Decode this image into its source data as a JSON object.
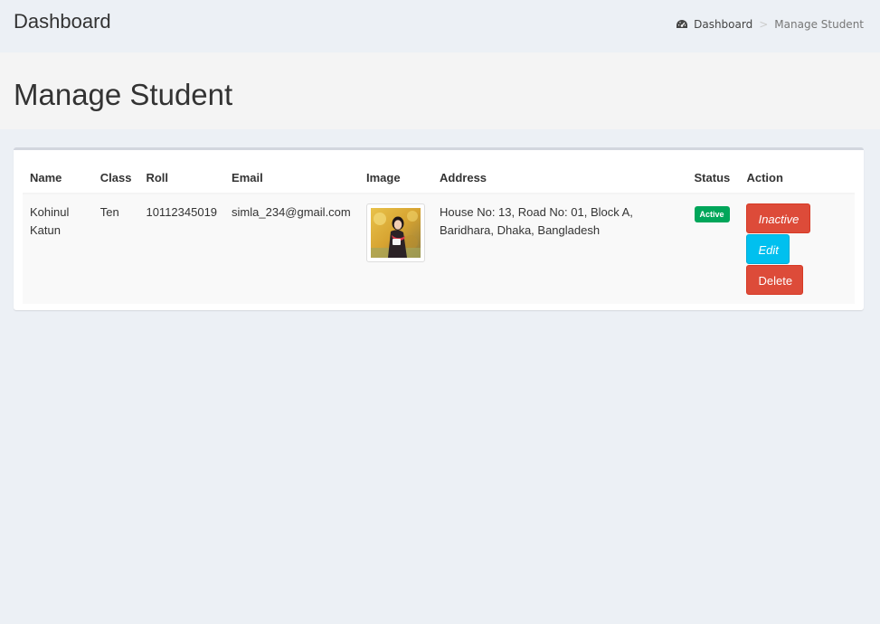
{
  "header": {
    "title": "Dashboard",
    "breadcrumb": {
      "home_label": "Dashboard",
      "separator": ">",
      "current": "Manage Student"
    }
  },
  "page": {
    "title": "Manage Student"
  },
  "table": {
    "columns": [
      "Name",
      "Class",
      "Roll",
      "Email",
      "Image",
      "Address",
      "Status",
      "Action"
    ],
    "rows": [
      {
        "name_line1": "Kohinul",
        "name_line2": "Katun",
        "class": "Ten",
        "roll": "10112345019",
        "email": "simla_234@gmail.com",
        "image_icon": "student-photo",
        "address_line1": "House No: 13, Road No: 01, Block A,",
        "address_line2": "Baridhara, Dhaka, Bangladesh",
        "status": "Active",
        "actions": {
          "inactive": "Inactive",
          "edit": "Edit",
          "delete": "Delete"
        }
      }
    ]
  },
  "colors": {
    "background": "#ecf0f5",
    "status_active": "#00a65a",
    "danger": "#dd4b39",
    "info": "#00c0ef"
  }
}
